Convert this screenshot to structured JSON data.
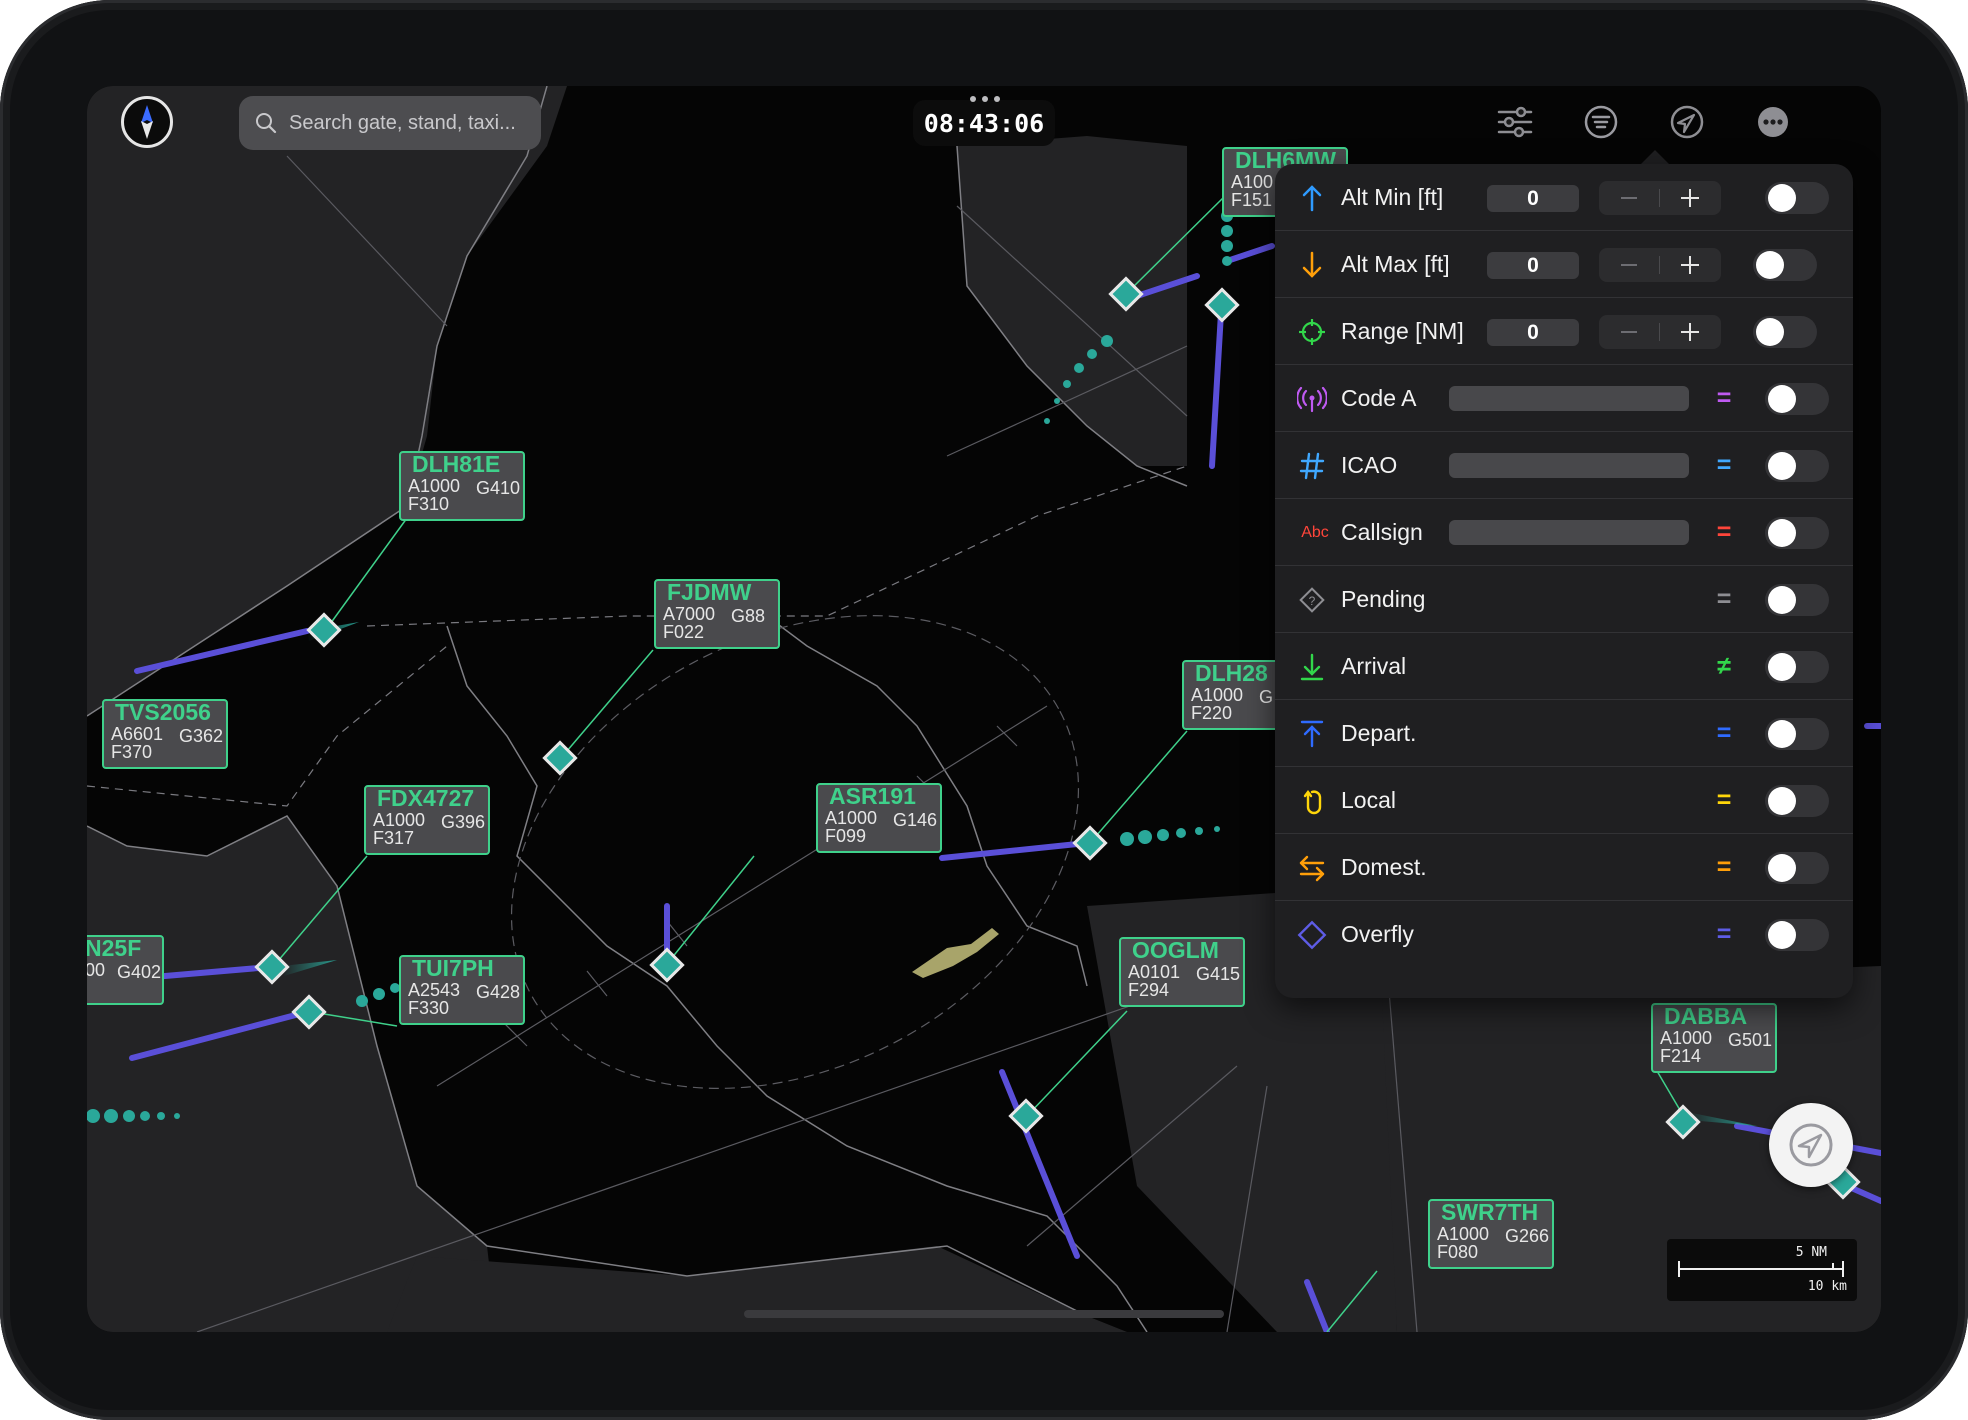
{
  "search": {
    "placeholder": "Search gate, stand, taxi..."
  },
  "clock": {
    "time": "08:43:06"
  },
  "toolbar": {
    "icons": [
      "sliders-icon",
      "filter-list-icon",
      "location-arrow-icon",
      "more-icon"
    ]
  },
  "filters": [
    {
      "id": "alt-min",
      "label": "Alt Min [ft]",
      "value": "0",
      "icon": "arrow-up-icon",
      "color": "#2f9bff",
      "kind": "stepper"
    },
    {
      "id": "alt-max",
      "label": "Alt Max [ft]",
      "value": "0",
      "icon": "arrow-down-icon",
      "color": "#ff9f0a",
      "kind": "stepper"
    },
    {
      "id": "range",
      "label": "Range [NM]",
      "value": "0",
      "icon": "crosshair-icon",
      "color": "#32d74b",
      "kind": "stepper"
    },
    {
      "id": "code-a",
      "label": "Code A",
      "icon": "antenna-icon",
      "color": "#bf5af2",
      "kind": "text",
      "op": "="
    },
    {
      "id": "icao",
      "label": "ICAO",
      "icon": "hash-icon",
      "color": "#40a8ff",
      "kind": "text",
      "op": "="
    },
    {
      "id": "callsign",
      "label": "Callsign",
      "icon": "abc-icon",
      "icon_text": "Abc",
      "color": "#ff453a",
      "kind": "text",
      "op": "="
    },
    {
      "id": "pending",
      "label": "Pending",
      "icon": "pending-diamond-icon",
      "color": "#8e8e93",
      "kind": "flag",
      "op": "="
    },
    {
      "id": "arrival",
      "label": "Arrival",
      "icon": "arrival-icon",
      "color": "#32d74b",
      "kind": "flag",
      "op": "≠"
    },
    {
      "id": "depart",
      "label": "Depart.",
      "icon": "departure-icon",
      "color": "#2f6bff",
      "kind": "flag",
      "op": "="
    },
    {
      "id": "local",
      "label": "Local",
      "icon": "local-loop-icon",
      "color": "#ffd60a",
      "kind": "flag",
      "op": "="
    },
    {
      "id": "domest",
      "label": "Domest.",
      "icon": "domestic-arrows-icon",
      "color": "#ff9f0a",
      "kind": "flag",
      "op": "="
    },
    {
      "id": "overfly",
      "label": "Overfly",
      "icon": "overfly-diamond-icon",
      "color": "#5e5ce6",
      "kind": "flag",
      "op": "="
    }
  ],
  "aircraft": [
    {
      "callsign": "DLH81E",
      "l2a": "A1000",
      "l2b": "G410",
      "l3": "F310"
    },
    {
      "callsign": "FJDMW",
      "l2a": "A7000",
      "l2b": "G88",
      "l3": "F022"
    },
    {
      "callsign": "TVS2056",
      "l2a": "A6601",
      "l2b": "G362",
      "l3": "F370"
    },
    {
      "callsign": "FDX4727",
      "l2a": "A1000",
      "l2b": "G396",
      "l3": "F317"
    },
    {
      "callsign": "ASR191",
      "l2a": "A1000",
      "l2b": "G146",
      "l3": "F099"
    },
    {
      "callsign": "DLH28",
      "l2a": "A1000",
      "l2b": "G",
      "l3": "F220"
    },
    {
      "callsign": "N25F",
      "l2a": "00",
      "l2b": "G402",
      "l3": ""
    },
    {
      "callsign": "TUI7PH",
      "l2a": "A2543",
      "l2b": "G428",
      "l3": "F330"
    },
    {
      "callsign": "OOGLM",
      "l2a": "A0101",
      "l2b": "G415",
      "l3": "F294"
    },
    {
      "callsign": "DABBA",
      "l2a": "A1000",
      "l2b": "G501",
      "l3": "F214"
    },
    {
      "callsign": "SWR7TH",
      "l2a": "A1000",
      "l2b": "G266",
      "l3": "F080"
    },
    {
      "callsign": "DLH6MW",
      "l2a": "A100",
      "l2b": "",
      "l3": "F151"
    }
  ],
  "scale": {
    "nm": "5 NM",
    "km": "10 km"
  },
  "colors": {
    "label_green": "#3fd18b",
    "track_purple": "#5a4fd8",
    "target_teal": "#2aa89a"
  }
}
